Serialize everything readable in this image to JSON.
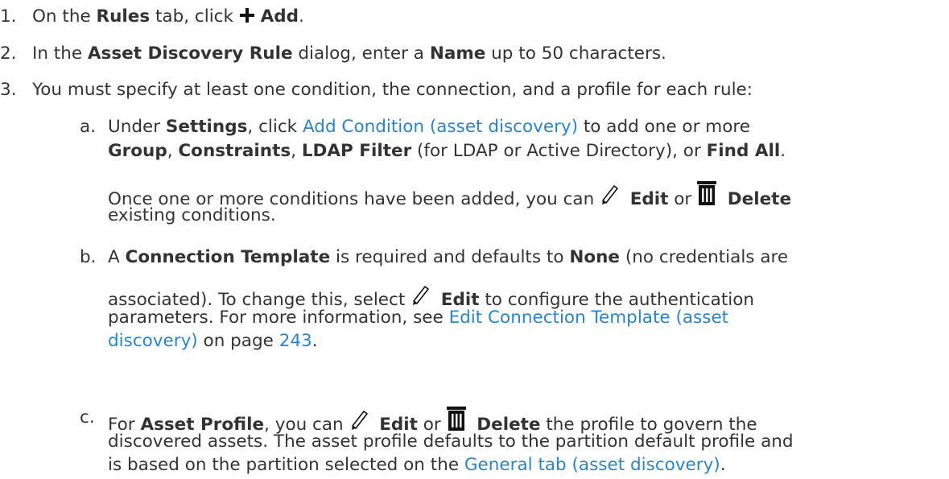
{
  "steps": {
    "s1": {
      "num": "1.",
      "a": "On the ",
      "rules": "Rules",
      "b": " tab, click ",
      "add_icon": "plus-icon",
      "add": "Add",
      "c": "."
    },
    "s2": {
      "num": "2.",
      "a": "In the ",
      "dialog": "Asset Discovery Rule",
      "b": " dialog, enter a ",
      "name": "Name",
      "c": " up to 50 characters."
    },
    "s3": {
      "num": "3.",
      "text": "You must specify at least one condition, the connection, and a profile for each rule:"
    }
  },
  "sub": {
    "a": {
      "letter": "a.",
      "l1_a": "Under ",
      "settings": "Settings",
      "l1_b": ", click ",
      "link": "Add Condition (asset discovery)",
      "l1_c": " to add one or more",
      "group": "Group",
      "l2_a": ", ",
      "constraints": "Constraints",
      "l2_b": ", ",
      "ldap": "LDAP Filter",
      "l2_c": " (for LDAP or Active Directory), or ",
      "findall": "Find All",
      "l2_d": ".",
      "p2_a": "Once one or more conditions have been added, you can ",
      "edit_icon": "pencil-icon",
      "edit": "Edit",
      "p2_b": " or ",
      "delete_icon": "trash-icon",
      "delete": "Delete",
      "p2_c": "existing conditions."
    },
    "b": {
      "letter": "b.",
      "l1_a": "A ",
      "conn": "Connection Template",
      "l1_b": " is required and defaults to ",
      "none": "None",
      "l1_c": " (no credentials are",
      "l2_a": "associated). To change this, select ",
      "edit_icon": "pencil-icon",
      "edit": "Edit",
      "l2_b": " to configure the authentication",
      "l3_a": "parameters. For more information, see ",
      "link1": "Edit Connection Template (asset",
      "link2": "discovery)",
      "l4_b": " on page ",
      "page": "243",
      "l4_c": "."
    },
    "c": {
      "letter": "c.",
      "l1_a": "For ",
      "profile": "Asset Profile",
      "l1_b": ", you can ",
      "edit_icon": "pencil-icon",
      "edit": "Edit",
      "l1_c": " or ",
      "delete_icon": "trash-icon",
      "delete": "Delete",
      "l1_d": " the profile to govern the",
      "l2": "discovered assets. The asset profile defaults to the partition default profile and",
      "l3_a": "is based on the partition selected on the ",
      "link": "General tab (asset discovery)",
      "l3_b": "."
    }
  }
}
